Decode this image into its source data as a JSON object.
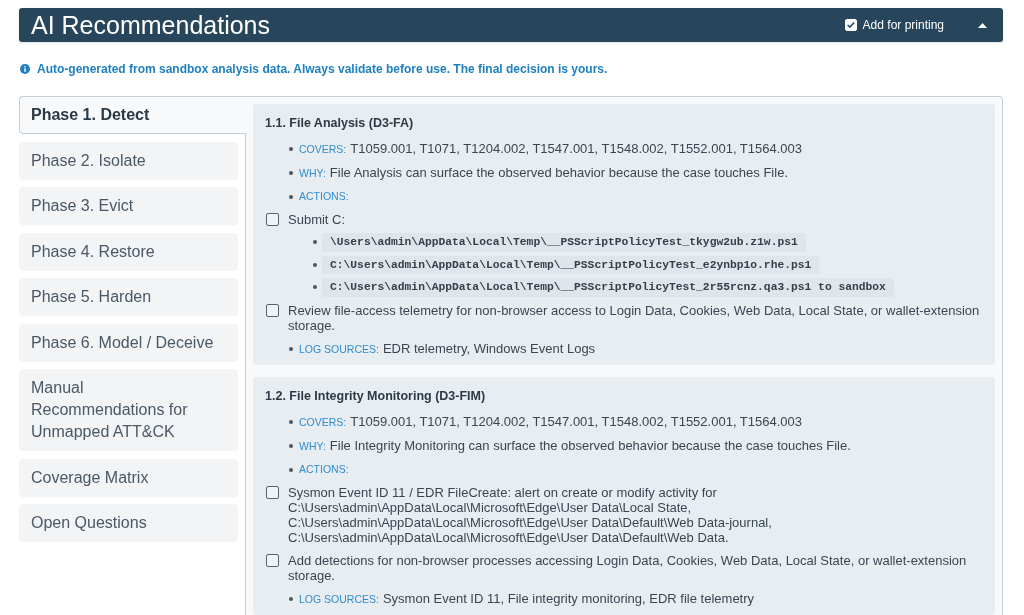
{
  "header": {
    "title": "AI Recommendations",
    "print_option": {
      "label": "Add for printing",
      "checked": true
    },
    "expanded": true
  },
  "notice": "Auto-generated from sandbox analysis data. Always validate before use. The final decision is yours.",
  "tabs": [
    {
      "label": "Phase 1. Detect",
      "selected": true
    },
    {
      "label": "Phase 2. Isolate",
      "selected": false
    },
    {
      "label": "Phase 3. Evict",
      "selected": false
    },
    {
      "label": "Phase 4. Restore",
      "selected": false
    },
    {
      "label": "Phase 5. Harden",
      "selected": false
    },
    {
      "label": "Phase 6. Model / Deceive",
      "selected": false
    },
    {
      "label": "Manual Recommendations for Unmapped ATT&CK",
      "selected": false
    },
    {
      "label": "Coverage Matrix",
      "selected": false
    },
    {
      "label": "Open Questions",
      "selected": false
    }
  ],
  "sections": [
    {
      "title": "1.1. File Analysis (D3-FA)",
      "items": [
        {
          "kind": "field",
          "label": "COVERS:",
          "value": "T1059.001, T1071, T1204.002, T1547.001, T1548.002, T1552.001, T1564.003"
        },
        {
          "kind": "field",
          "label": "WHY:",
          "value": "File Analysis can surface the observed behavior because the case touches File."
        },
        {
          "kind": "field",
          "label": "ACTIONS:"
        },
        {
          "kind": "task",
          "checked": false,
          "text": "Submit C:",
          "code": [
            "\\Users\\admin\\AppData\\Local\\Temp\\__PSScriptPolicyTest_tkygw2ub.z1w.ps1",
            "C:\\Users\\admin\\AppData\\Local\\Temp\\__PSScriptPolicyTest_e2ynbp1o.rhe.ps1",
            "C:\\Users\\admin\\AppData\\Local\\Temp\\__PSScriptPolicyTest_2r55rcnz.qa3.ps1 to sandbox"
          ]
        },
        {
          "kind": "task",
          "checked": false,
          "text": "Review file-access telemetry for non-browser access to Login Data, Cookies, Web Data, Local State, or wallet-extension storage."
        },
        {
          "kind": "field",
          "label": "LOG SOURCES:",
          "value": "EDR telemetry, Windows Event Logs"
        }
      ]
    },
    {
      "title": "1.2. File Integrity Monitoring (D3-FIM)",
      "items": [
        {
          "kind": "field",
          "label": "COVERS:",
          "value": "T1059.001, T1071, T1204.002, T1547.001, T1548.002, T1552.001, T1564.003"
        },
        {
          "kind": "field",
          "label": "WHY:",
          "value": "File Integrity Monitoring can surface the observed behavior because the case touches File."
        },
        {
          "kind": "field",
          "label": "ACTIONS:"
        },
        {
          "kind": "task",
          "checked": false,
          "text": "Sysmon Event ID 11 / EDR FileCreate: alert on create or modify activity for C:\\Users\\admin\\AppData\\Local\\Microsoft\\Edge\\User Data\\Local State, C:\\Users\\admin\\AppData\\Local\\Microsoft\\Edge\\User Data\\Default\\Web Data-journal, C:\\Users\\admin\\AppData\\Local\\Microsoft\\Edge\\User Data\\Default\\Web Data."
        },
        {
          "kind": "task",
          "checked": false,
          "text": "Add detections for non-browser processes accessing Login Data, Cookies, Web Data, Local State, or wallet-extension storage."
        },
        {
          "kind": "field",
          "label": "LOG SOURCES:",
          "value": "Sysmon Event ID 11, File integrity monitoring, EDR file telemetry"
        }
      ]
    }
  ]
}
